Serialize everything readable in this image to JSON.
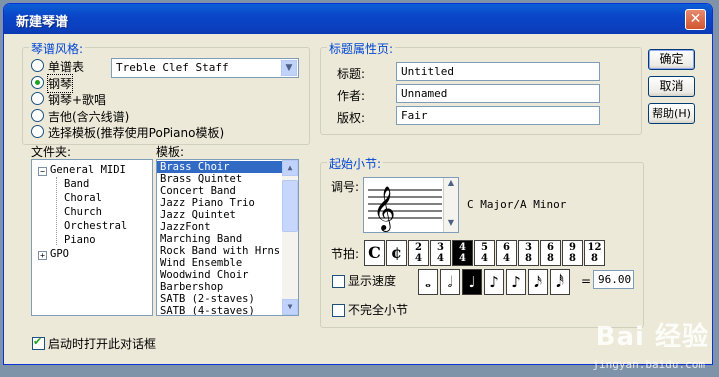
{
  "window": {
    "title": "新建琴谱"
  },
  "style_group": {
    "label": "琴谱风格:",
    "options": [
      {
        "label": "单谱表",
        "selected": false
      },
      {
        "label": "钢琴",
        "selected": true
      },
      {
        "label": "钢琴+歌唱",
        "selected": false
      },
      {
        "label": "吉他(含六线谱)",
        "selected": false
      },
      {
        "label": "选择模板(推荐使用PoPiano模板)",
        "selected": false
      }
    ],
    "staff_select": "Treble Clef Staff"
  },
  "folder": {
    "label": "文件夹:",
    "items": [
      {
        "label": "General MIDI",
        "level": 0,
        "expander": "⊟"
      },
      {
        "label": "Band",
        "level": 1
      },
      {
        "label": "Choral",
        "level": 1
      },
      {
        "label": "Church",
        "level": 1
      },
      {
        "label": "Orchestral",
        "level": 1
      },
      {
        "label": "Piano",
        "level": 1
      },
      {
        "label": "GPO",
        "level": 0,
        "expander": "⊞"
      }
    ]
  },
  "templates": {
    "label": "模板:",
    "items": [
      "Brass Choir",
      "Brass Quintet",
      "Concert Band",
      "Jazz Piano Trio",
      "Jazz Quintet",
      "JazzFont",
      "Marching Band",
      "Rock Band with Hrns",
      "Wind Ensemble",
      "Woodwind Choir",
      "Barbershop",
      "SATB (2-staves)",
      "SATB (4-staves)"
    ],
    "selected_index": 0
  },
  "title_props": {
    "label": "标题属性页:",
    "fields": [
      {
        "label": "标题:",
        "value": "Untitled"
      },
      {
        "label": "作者:",
        "value": "Unnamed"
      },
      {
        "label": "版权:",
        "value": "Fair"
      }
    ]
  },
  "buttons": {
    "ok": "确定",
    "cancel": "取消",
    "help": "帮助(H)"
  },
  "start_measure": {
    "label": "起始小节:",
    "key_label": "调号:",
    "key_value": "C Major/A Minor",
    "time_label": "节拍:",
    "time_signatures": [
      "C",
      "¢",
      "2/4",
      "3/4",
      "4/4",
      "5/4",
      "6/4",
      "3/8",
      "6/8",
      "9/8",
      "12/8"
    ],
    "time_selected_index": 4,
    "show_tempo_label": "显示速度",
    "show_tempo_checked": false,
    "tempo_notes": [
      "𝅝",
      "𝅗𝅥",
      "♩",
      "♪",
      "♪",
      "𝅘𝅥𝅯",
      "𝅘𝅥𝅰"
    ],
    "tempo_note_selected": 2,
    "tempo_equals": "=",
    "tempo_value": "96.00",
    "pickup_label": "不完全小节",
    "pickup_checked": false
  },
  "startup": {
    "label": "启动时打开此对话框",
    "checked": true
  },
  "watermark": {
    "brand": "Bai 经验",
    "url": "jingyan.baidu.com"
  },
  "colors": {
    "titlebar": "#0a46c8",
    "group_label": "#0046d5",
    "selection": "#316ac5"
  }
}
